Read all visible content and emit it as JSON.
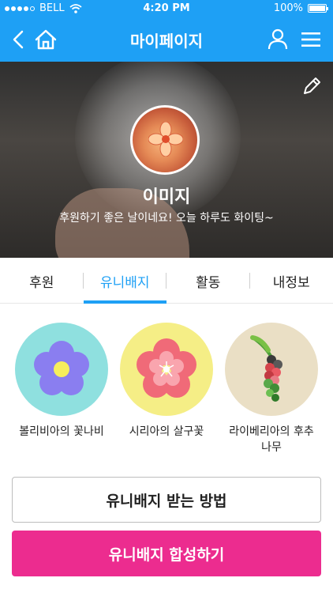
{
  "status_bar": {
    "carrier": "BELL",
    "time": "4:20 PM",
    "battery": "100%"
  },
  "app_bar": {
    "title": "마이페이지"
  },
  "profile": {
    "name": "이미지",
    "greeting": "후원하기 좋은 날이네요! 오늘 하루도 화이팅~"
  },
  "tabs": [
    {
      "label": "후원",
      "active": false
    },
    {
      "label": "유니배지",
      "active": true
    },
    {
      "label": "활동",
      "active": false
    },
    {
      "label": "내정보",
      "active": false
    }
  ],
  "badges": [
    {
      "label": "볼리비아의 꽃나비",
      "color": "#8fe0df"
    },
    {
      "label": "시리아의 살구꽃",
      "color": "#f5ee86"
    },
    {
      "label": "라이베리아의 후추나무",
      "color": "#eadfc5"
    }
  ],
  "buttons": {
    "how_to_get": "유니배지 받는 방법",
    "combine": "유니배지 합성하기"
  },
  "colors": {
    "primary": "#1ea0f5",
    "accent": "#ec2c8f"
  }
}
